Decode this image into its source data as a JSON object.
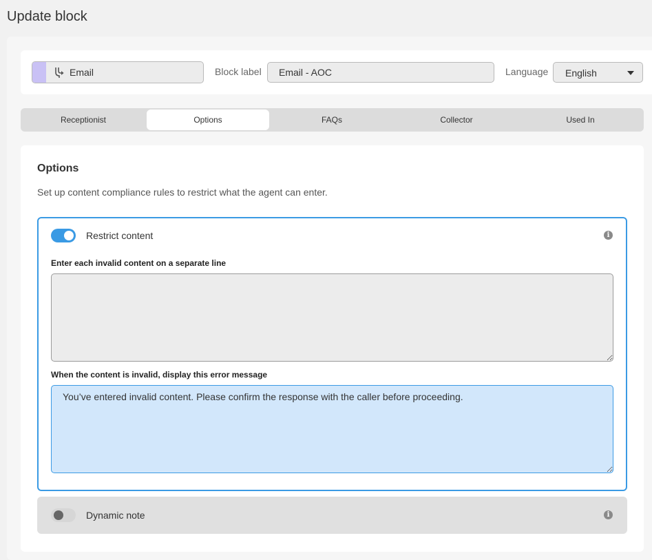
{
  "page": {
    "title": "Update block"
  },
  "header": {
    "block_type": {
      "label": "Email",
      "icon": "routing-fork-icon",
      "accent": "#c9c1f5"
    },
    "block_label": {
      "label": "Block label",
      "value": "Email - AOC"
    },
    "language": {
      "label": "Language",
      "selected": "English"
    }
  },
  "tabs": [
    {
      "label": "Receptionist",
      "active": false
    },
    {
      "label": "Options",
      "active": true
    },
    {
      "label": "FAQs",
      "active": false
    },
    {
      "label": "Collector",
      "active": false
    },
    {
      "label": "Used In",
      "active": false
    }
  ],
  "options": {
    "title": "Options",
    "description": "Set up content compliance rules to restrict what the agent can enter.",
    "restrict_content": {
      "label": "Restrict content",
      "enabled": true,
      "invalid_content_label": "Enter each invalid content on a separate line",
      "invalid_content_value": "",
      "error_message_label": "When the content is invalid, display this error message",
      "error_message_value": "You’ve entered invalid content. Please confirm the response with the caller before proceeding."
    },
    "dynamic_note": {
      "label": "Dynamic note",
      "enabled": false
    }
  },
  "colors": {
    "accent": "#3a9ae4",
    "highlight_fill": "#d2e7fb",
    "page_background": "#f1f1f1"
  }
}
